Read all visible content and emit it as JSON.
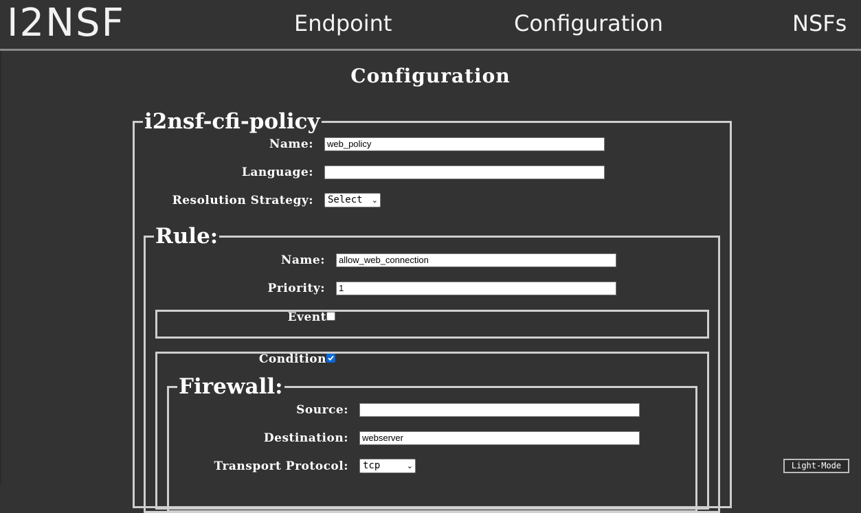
{
  "header": {
    "logo": "I2NSF",
    "nav": [
      {
        "label": "Endpoint"
      },
      {
        "label": "Configuration"
      },
      {
        "label": "NSFs"
      }
    ]
  },
  "page_title": "Configuration",
  "policy": {
    "legend": "i2nsf-cfi-policy",
    "name_label": "Name:",
    "name_value": "web_policy",
    "language_label": "Language:",
    "language_value": "",
    "resolution_label": "Resolution Strategy:",
    "resolution_value": "Select",
    "rule": {
      "legend": "Rule:",
      "name_label": "Name:",
      "name_value": "allow_web_connection",
      "priority_label": "Priority:",
      "priority_value": "1",
      "event_label": "Event",
      "event_checked": false,
      "condition_label": "Condition",
      "condition_checked": true,
      "firewall": {
        "legend": "Firewall:",
        "source_label": "Source:",
        "source_value": "",
        "destination_label": "Destination:",
        "destination_value": "webserver",
        "transport_label": "Transport Protocol:",
        "transport_value": "tcp"
      }
    }
  },
  "mode_toggle": "Light-Mode",
  "colors": {
    "background": "#333333",
    "text": "#ffffff",
    "border": "#cfcfcf",
    "checkbox_checked": "#0b68d9"
  }
}
